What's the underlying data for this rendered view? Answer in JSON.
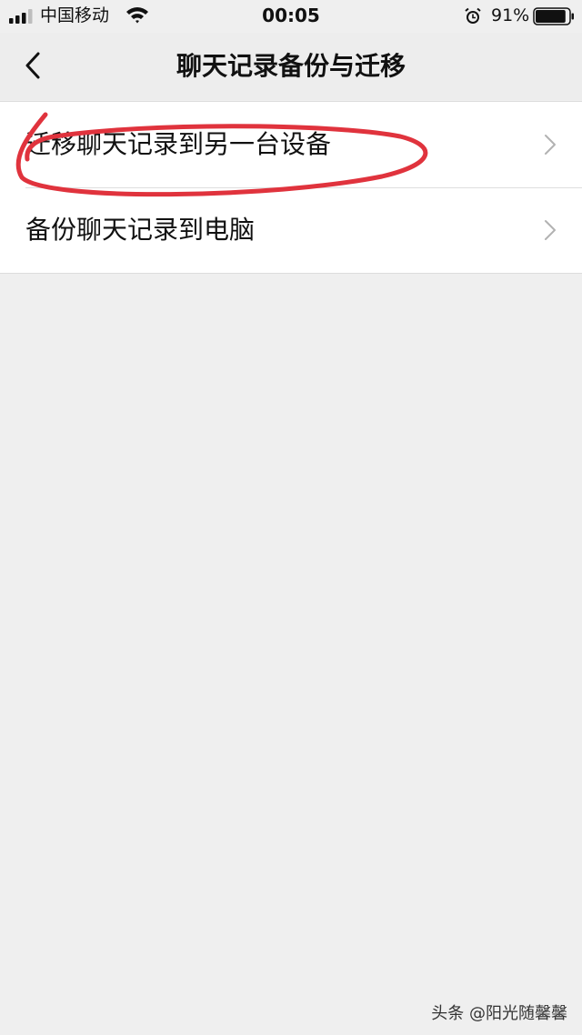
{
  "status_bar": {
    "carrier": "中国移动",
    "time": "00:05",
    "battery_percent": "91%",
    "battery_level": 0.91,
    "icons": [
      "signal-icon",
      "wifi-icon",
      "alarm-icon",
      "battery-icon"
    ]
  },
  "nav": {
    "title": "聊天记录备份与迁移",
    "back_icon": "chevron-left-icon"
  },
  "menu": {
    "items": [
      {
        "label": "迁移聊天记录到另一台设备",
        "icon": "chevron-right-icon"
      },
      {
        "label": "备份聊天记录到电脑",
        "icon": "chevron-right-icon"
      }
    ]
  },
  "annotation": {
    "color": "#e0333d",
    "target": "迁移聊天记录到另一台设备"
  },
  "watermark": "头条 @阳光随馨馨",
  "colors": {
    "background": "#efefef",
    "list_background": "#ffffff",
    "chevron": "#b2b2b2",
    "annotation": "#e0333d"
  }
}
